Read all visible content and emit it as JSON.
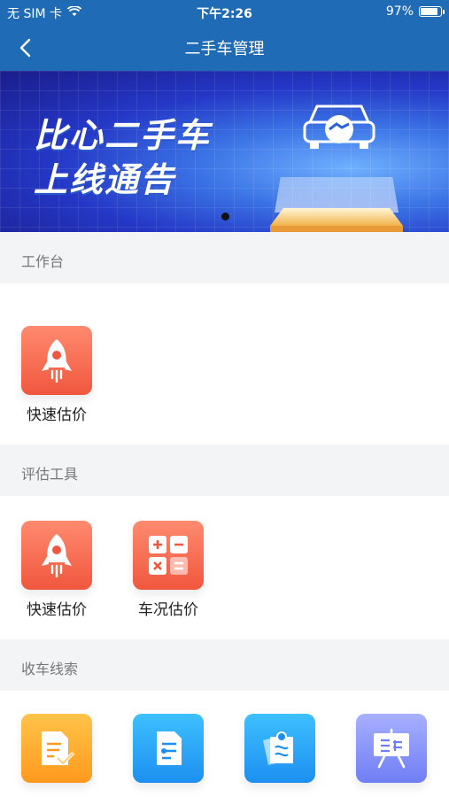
{
  "status_bar": {
    "carrier": "无 SIM 卡",
    "time": "下午2:26",
    "battery": "97%",
    "battery_level": 0.97
  },
  "nav": {
    "title": "二手车管理"
  },
  "banner": {
    "line1": "比心二手车",
    "line2": "上线通告"
  },
  "sections": {
    "workbench": {
      "title": "工作台",
      "items": [
        {
          "label": "快速估价",
          "icon": "rocket-icon"
        }
      ]
    },
    "tools": {
      "title": "评估工具",
      "items": [
        {
          "label": "快速估价",
          "icon": "rocket-icon"
        },
        {
          "label": "车况估价",
          "icon": "calculator-icon"
        }
      ]
    },
    "leads": {
      "title": "收车线索",
      "items": [
        {
          "icon": "document-check-icon"
        },
        {
          "icon": "file-list-icon"
        },
        {
          "icon": "notes-icon"
        },
        {
          "icon": "presentation-board-icon"
        }
      ]
    }
  },
  "colors": {
    "primary": "#1f6bb5",
    "section_bg": "#f3f4f6",
    "orange_tile": "#f0573e",
    "yellow_tile": "#ff9a1e",
    "blue_tile": "#1d8ff0",
    "purple_tile": "#6f7ef5"
  }
}
